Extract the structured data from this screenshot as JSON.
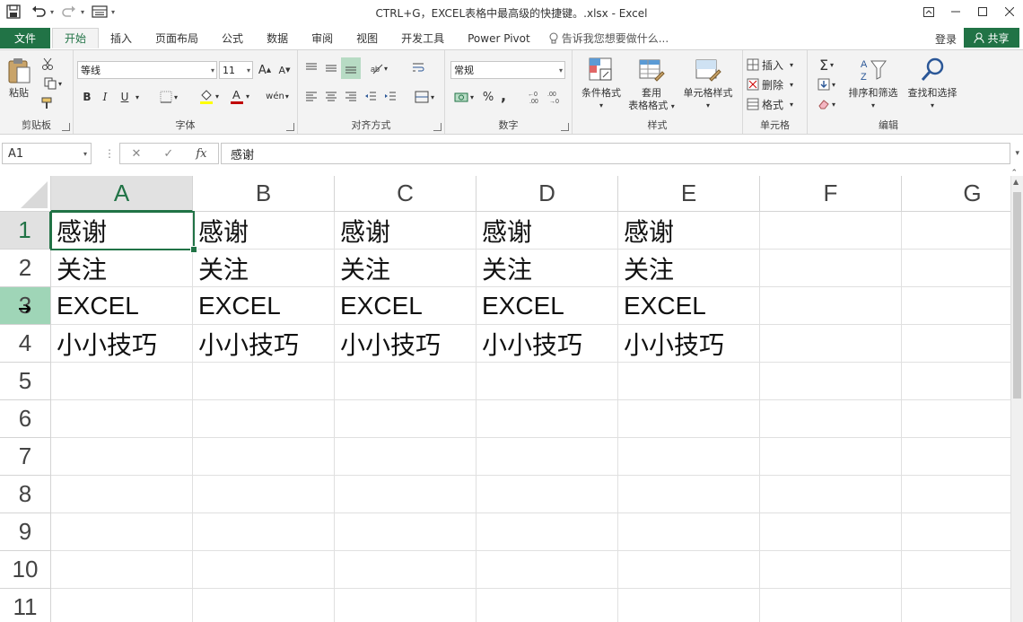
{
  "window": {
    "title": "CTRL+G，EXCEL表格中最高级的快捷键。.xlsx - Excel",
    "controls": [
      "restore-ribbon",
      "minimize",
      "maximize",
      "close"
    ]
  },
  "qat": {
    "save_icon": "save-icon",
    "undo_icon": "undo-icon",
    "redo_icon": "redo-icon",
    "form_icon": "form-icon"
  },
  "tabs": {
    "file": "文件",
    "items": [
      "开始",
      "插入",
      "页面布局",
      "公式",
      "数据",
      "审阅",
      "视图",
      "开发工具",
      "Power Pivot"
    ],
    "active": "开始",
    "tell_me": "告诉我您想要做什么...",
    "login": "登录",
    "share": "共享"
  },
  "ribbon": {
    "clipboard": {
      "label": "剪贴板",
      "paste": "粘贴"
    },
    "font": {
      "label": "字体",
      "font_name": "等线",
      "font_size": "11",
      "bold": "B",
      "italic": "I",
      "underline": "U"
    },
    "alignment": {
      "label": "对齐方式"
    },
    "number": {
      "label": "数字",
      "format": "常规",
      "percent": "%",
      "comma": ","
    },
    "styles": {
      "label": "样式",
      "conditional": "条件格式",
      "table_line1": "套用",
      "table_line2": "表格格式",
      "cell_styles": "单元格样式"
    },
    "cells": {
      "label": "单元格",
      "insert": "插入",
      "delete": "删除",
      "format": "格式"
    },
    "editing": {
      "label": "编辑",
      "sort": "排序和筛选",
      "find": "查找和选择"
    }
  },
  "formula_bar": {
    "name_box": "A1",
    "cancel": "✕",
    "enter": "✓",
    "fx": "fx",
    "content": "感谢"
  },
  "sheet": {
    "columns": [
      "A",
      "B",
      "C",
      "D",
      "E",
      "F",
      "G"
    ],
    "rows": [
      "1",
      "2",
      "3",
      "4",
      "5",
      "6",
      "7",
      "8",
      "9",
      "10",
      "11"
    ],
    "selected_cell": "A1",
    "cells": [
      [
        "感谢",
        "感谢",
        "感谢",
        "感谢",
        "感谢"
      ],
      [
        "关注",
        "关注",
        "关注",
        "关注",
        "关注"
      ],
      [
        "EXCEL",
        "EXCEL",
        "EXCEL",
        "EXCEL",
        "EXCEL"
      ],
      [
        "小小技巧",
        "小小技巧",
        "小小技巧",
        "小小技巧",
        "小小技巧"
      ]
    ]
  },
  "colors": {
    "accent": "#217346",
    "header_selected": "#e1e1e1",
    "row_hover": "#9fd5b7"
  }
}
